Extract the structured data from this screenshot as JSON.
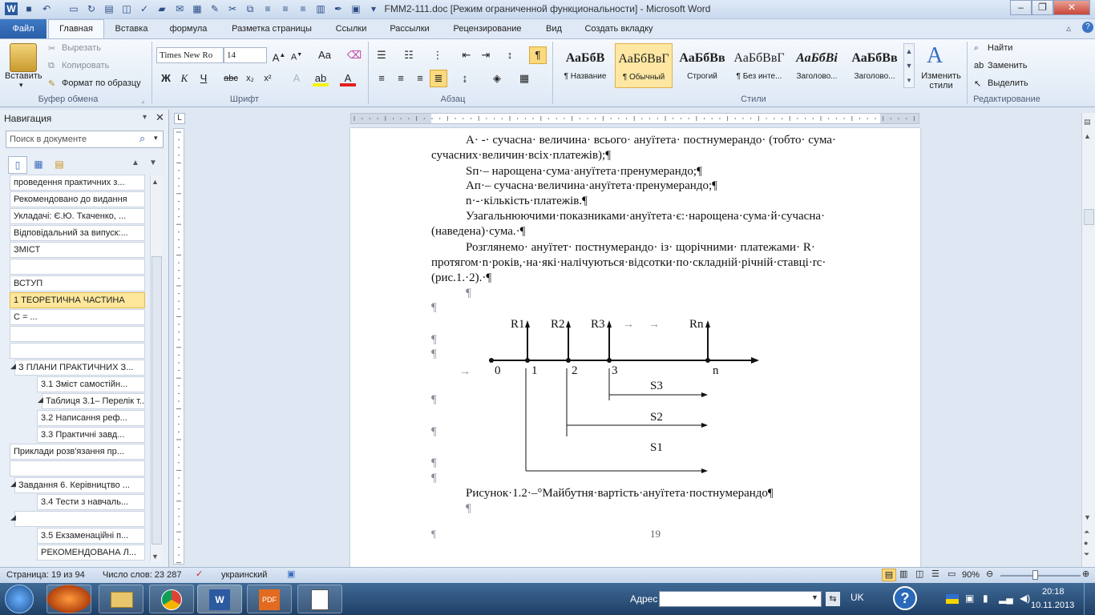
{
  "window": {
    "title": "FMM2-111.doc [Режим ограниченной функциональности] - Microsoft Word"
  },
  "tabs": {
    "file": "Файл",
    "home": "Главная",
    "insert": "Вставка",
    "formula": "формула",
    "layout": "Разметка страницы",
    "refs": "Ссылки",
    "mailings": "Рассылки",
    "review": "Рецензирование",
    "view": "Вид",
    "addin": "Создать вкладку"
  },
  "clipboard": {
    "paste": "Вставить",
    "cut": "Вырезать",
    "copy": "Копировать",
    "format_painter": "Формат по образцу",
    "label": "Буфер обмена"
  },
  "font": {
    "name": "Times New Ro",
    "size": "14",
    "label": "Шрифт",
    "aa": "Aa"
  },
  "paragraph": {
    "label": "Абзац"
  },
  "styles": {
    "label": "Стили",
    "items": [
      {
        "preview": "АаБбВ",
        "name": "¶ Название"
      },
      {
        "preview": "АаБбВвГ",
        "name": "¶ Обычный"
      },
      {
        "preview": "АаБбВв",
        "name": "Строгий"
      },
      {
        "preview": "АаБбВвГ",
        "name": "¶ Без инте..."
      },
      {
        "preview": "АаБбВі",
        "name": "Заголово..."
      },
      {
        "preview": "АаБбВв",
        "name": "Заголово..."
      }
    ],
    "change": "Изменить стили"
  },
  "editing": {
    "label": "Редактирование",
    "find": "Найти",
    "replace": "Заменить",
    "select": "Выделить"
  },
  "nav": {
    "title": "Навигация",
    "search_placeholder": "Поиск в документе",
    "items": [
      "проведення практичних з...",
      "Рекомендовано до видання",
      "Укладачі:  Є.Ю. Ткаченко, ...",
      "Відповідальний за випуск:...",
      "ЗМІСТ",
      "",
      "ВСТУП",
      "1  ТЕОРЕТИЧНА ЧАСТИНА",
      "С =                                  ...",
      "",
      "",
      "З ПЛАНИ   ПРАКТИЧНИХ З...",
      "3.1  Зміст самостійн...",
      "Таблиця 3.1– Перелік т...",
      "3.2  Написання реф...",
      "3.3  Практичні завд...",
      "Приклади розв'язання пр...",
      "",
      "Завдання 6. Керівництво ...",
      "3.4  Тести з навчаль...",
      "",
      "3.5 Екзаменаційні п...",
      "РЕКОМЕНДОВАНА Л..."
    ]
  },
  "doc": {
    "lines": [
      "А· -· сучасна· величина· всього· ануїтета· постнумерандо· (тобто· сума·",
      "сучасних·величин·всіх·платежів);¶",
      "Sп·– нарощена·сума·ануїтета·пренумерандо;¶",
      "Ап·– сучасна·величина·ануїтета·пренумерандо;¶",
      "n·-·кількість·платежів.¶",
      "Узагальнюючими·показниками·ануїтета·є:·нарощена·сума·й·сучасна·",
      "(наведена)·сума.·¶",
      "Розглянемо· ануїтет· постнумерандо· із· щорічними· платежами· R·",
      "протягом·n·років,·на·які·налічуються·відсотки·по·складній·річній·ставці·rс·",
      "(рис.1.·2).·¶"
    ],
    "caption": "Рисунок·1.2·–°Майбутня·вартість·ануїтета·постнумерандо¶",
    "page_number": "19",
    "pilcrow": "¶",
    "figure": {
      "r": [
        "R1",
        "R2",
        "R3",
        "Rn"
      ],
      "ticks": [
        "0",
        "1",
        "2",
        "3",
        "n"
      ],
      "s": [
        "S3",
        "S2",
        "S1"
      ]
    }
  },
  "status": {
    "page": "Страница: 19 из 94",
    "words": "Число слов: 23 287",
    "lang": "украинский",
    "zoom": "90%"
  },
  "taskbar": {
    "address": "Адрес",
    "lang": "UK",
    "time": "20:18",
    "date": "10.11.2013"
  }
}
